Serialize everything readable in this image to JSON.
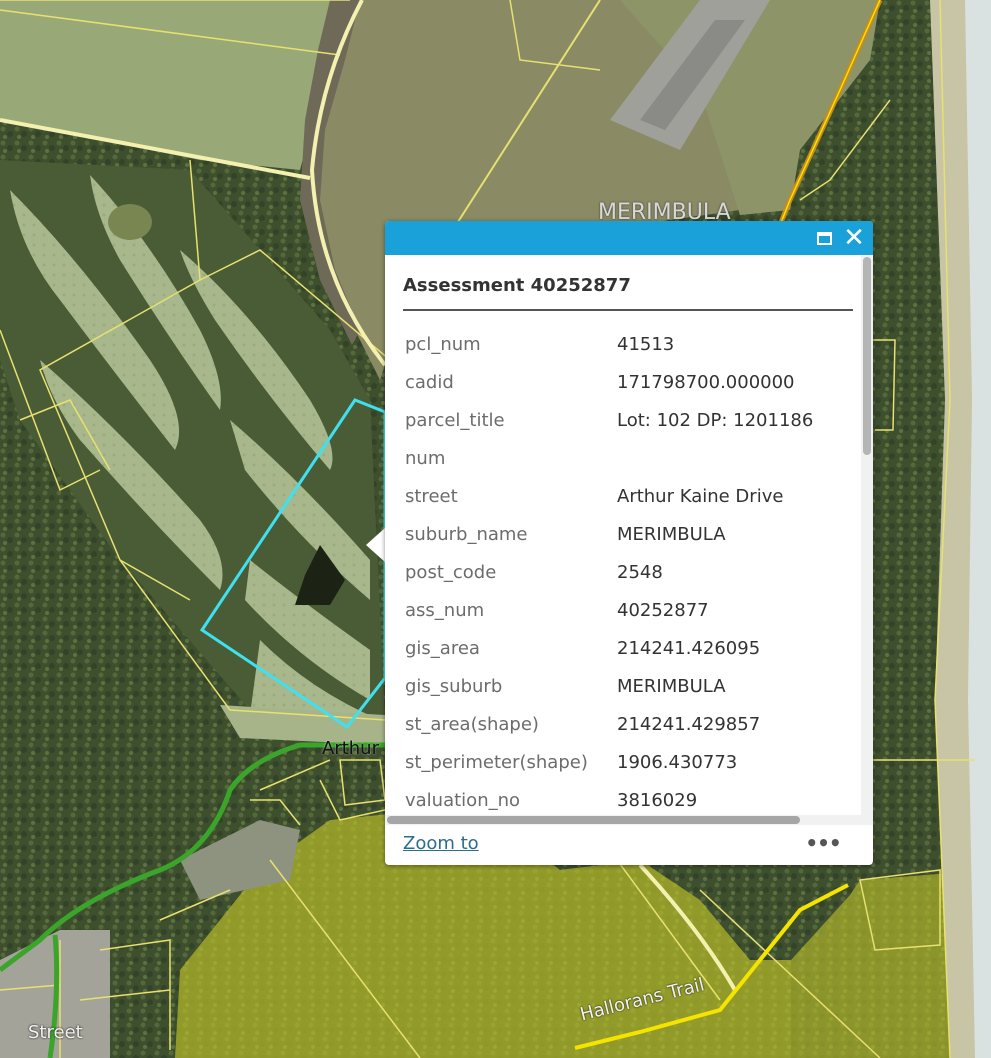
{
  "map": {
    "labels": {
      "town": "MERIMBULA",
      "road_arthur": "Arthur",
      "road_street": "Street",
      "road_trail": "Hallorans Trail"
    },
    "colors": {
      "selected_outline": "#3fe0ef",
      "parcel_lines": "#e8e070",
      "zone_fill": "#b6bc2a",
      "road_green": "#3aa52a",
      "road_yellow": "#f4e400"
    }
  },
  "popup": {
    "header_color": "#1ba1d9",
    "maximize_icon": "maximize-icon",
    "close_icon": "close-icon",
    "close_glyph": "✕",
    "title": "Assessment 40252877",
    "fields": [
      {
        "name": "pcl_num",
        "value": "41513"
      },
      {
        "name": "cadid",
        "value": "171798700.000000"
      },
      {
        "name": "parcel_title",
        "value": "Lot: 102 DP: 1201186"
      },
      {
        "name": "num",
        "value": ""
      },
      {
        "name": "street",
        "value": "Arthur Kaine Drive"
      },
      {
        "name": "suburb_name",
        "value": "MERIMBULA"
      },
      {
        "name": "post_code",
        "value": "2548"
      },
      {
        "name": "ass_num",
        "value": "40252877"
      },
      {
        "name": "gis_area",
        "value": "214241.426095"
      },
      {
        "name": "gis_suburb",
        "value": "MERIMBULA"
      },
      {
        "name": "st_area(shape)",
        "value": "214241.429857"
      },
      {
        "name": "st_perimeter(shape)",
        "value": "1906.430773"
      },
      {
        "name": "valuation_no",
        "value": "3816029"
      }
    ],
    "zoom_label": "Zoom to",
    "more_label": "•••"
  }
}
